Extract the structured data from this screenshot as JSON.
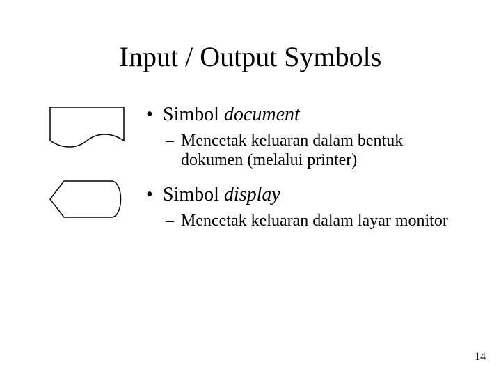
{
  "title": "Input / Output Symbols",
  "items": [
    {
      "label_plain": "Simbol ",
      "label_italic": "document",
      "sub": "Mencetak keluaran dalam bentuk dokumen (melalui printer)"
    },
    {
      "label_plain": "Simbol ",
      "label_italic": "display",
      "sub": "Mencetak keluaran dalam layar monitor"
    }
  ],
  "page_number": "14",
  "icons": {
    "document": "document-symbol-icon",
    "display": "display-symbol-icon"
  }
}
